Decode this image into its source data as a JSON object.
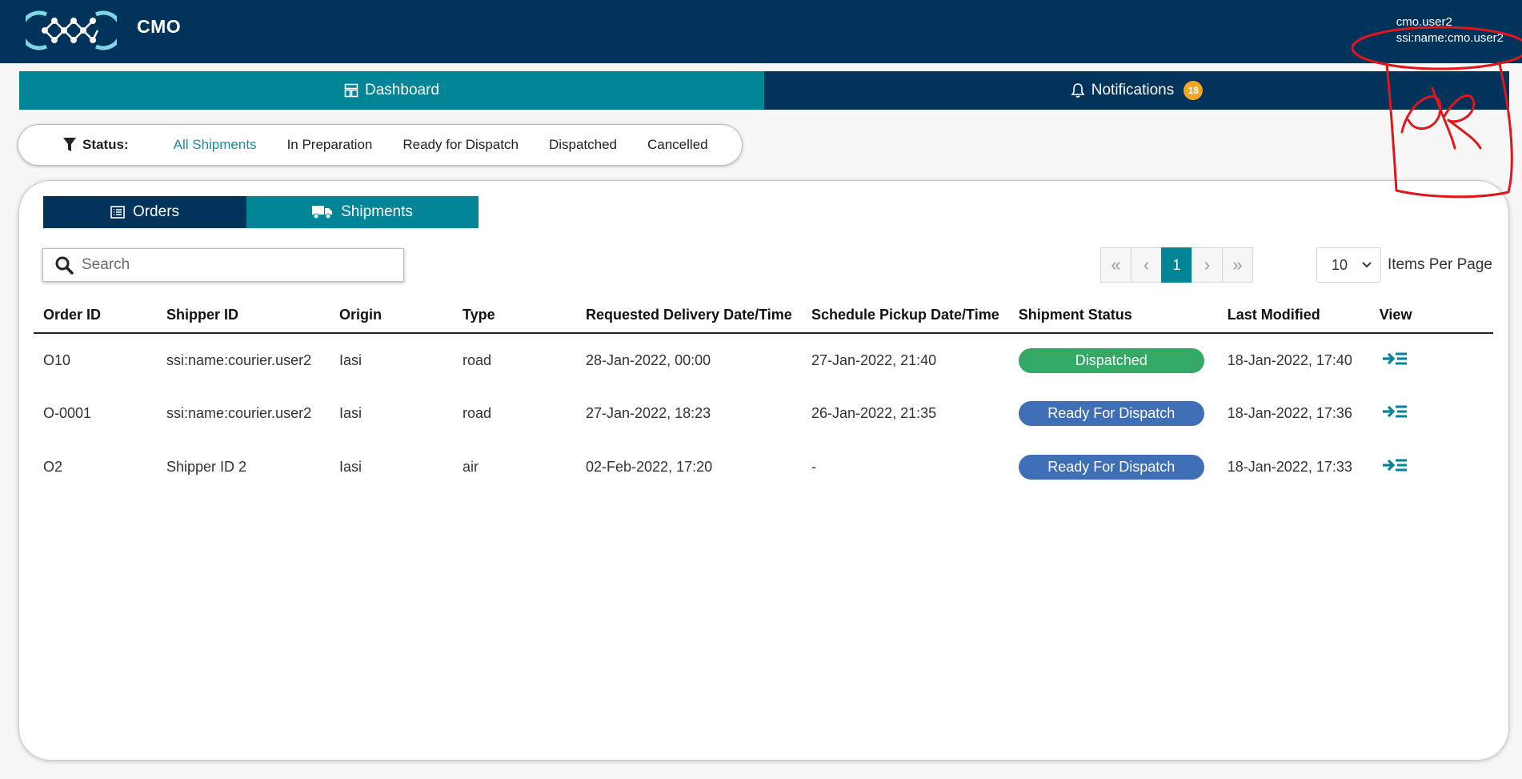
{
  "header": {
    "app_title": "CMO",
    "user_name": "cmo.user2",
    "user_ssi": "ssi:name:cmo.user2"
  },
  "nav": {
    "dashboard_label": "Dashboard",
    "notifications_label": "Notifications",
    "notifications_count": "18"
  },
  "status_filter": {
    "label": "Status:",
    "options": [
      "All Shipments",
      "In Preparation",
      "Ready for Dispatch",
      "Dispatched",
      "Cancelled"
    ],
    "active": "All Shipments"
  },
  "subtabs": {
    "orders_label": "Orders",
    "shipments_label": "Shipments"
  },
  "search": {
    "placeholder": "Search",
    "value": ""
  },
  "pagination": {
    "first": "«",
    "prev": "‹",
    "current": "1",
    "next": "›",
    "last": "»"
  },
  "per_page": {
    "value": "10",
    "label": "Items Per Page"
  },
  "table": {
    "columns": [
      "Order ID",
      "Shipper ID",
      "Origin",
      "Type",
      "Requested Delivery Date/Time",
      "Schedule Pickup Date/Time",
      "Shipment Status",
      "Last Modified",
      "View"
    ],
    "rows": [
      {
        "order_id": "O10",
        "shipper_id": "ssi:name:courier.user2",
        "origin": "Iasi",
        "type": "road",
        "requested": "28-Jan-2022, 00:00",
        "pickup": "27-Jan-2022, 21:40",
        "status": "Dispatched",
        "status_color": "#34a865",
        "modified": "18-Jan-2022, 17:40"
      },
      {
        "order_id": "O-0001",
        "shipper_id": "ssi:name:courier.user2",
        "origin": "Iasi",
        "type": "road",
        "requested": "27-Jan-2022, 18:23",
        "pickup": "26-Jan-2022, 21:35",
        "status": "Ready For Dispatch",
        "status_color": "#3e6eb5",
        "modified": "18-Jan-2022, 17:36"
      },
      {
        "order_id": "O2",
        "shipper_id": "Shipper ID 2",
        "origin": "Iasi",
        "type": "air",
        "requested": "02-Feb-2022, 17:20",
        "pickup": "-",
        "status": "Ready For Dispatch",
        "status_color": "#3e6eb5",
        "modified": "18-Jan-2022, 17:33"
      }
    ]
  },
  "colors": {
    "primary_dark": "#02335a",
    "primary_teal": "#018597",
    "badge": "#f5a623",
    "annotation": "#e0161b"
  },
  "icons": {
    "logo": "cmo-logo",
    "dashboard": "dashboard-icon",
    "notifications": "bell-icon",
    "filter": "filter-icon",
    "orders": "list-icon",
    "shipments": "truck-icon",
    "search": "search-icon",
    "view": "arrow-list-icon",
    "dropdown": "chevron-down-icon"
  }
}
